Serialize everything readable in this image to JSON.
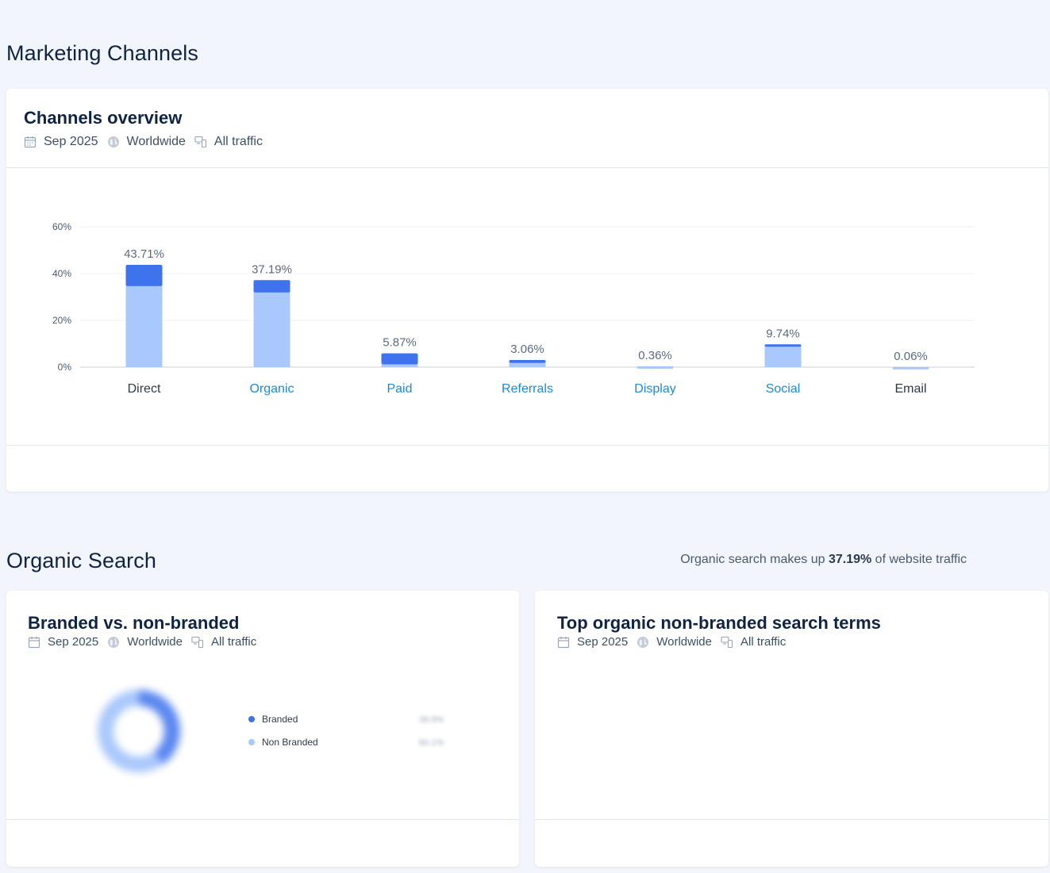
{
  "marketing": {
    "title": "Marketing Channels",
    "overview": {
      "title": "Channels overview",
      "meta": {
        "date": "Sep 2025",
        "region": "Worldwide",
        "traffic": "All traffic"
      }
    }
  },
  "chart_data": {
    "type": "bar",
    "stacked": true,
    "categories": [
      "Direct",
      "Organic",
      "Paid",
      "Referrals",
      "Display",
      "Social",
      "Email"
    ],
    "linked_categories": [
      "Organic",
      "Paid",
      "Referrals",
      "Display",
      "Social"
    ],
    "totals": [
      43.71,
      37.19,
      5.87,
      3.06,
      0.36,
      9.74,
      0.06
    ],
    "total_labels": [
      "43.71%",
      "37.19%",
      "5.87%",
      "3.06%",
      "0.36%",
      "9.74%",
      "0.06%"
    ],
    "series": [
      {
        "values": [
          34.6,
          31.9,
          1.2,
          1.8,
          0.36,
          9.0,
          0.06
        ],
        "color": "#a9c8fb"
      },
      {
        "values": [
          9.11,
          5.29,
          4.67,
          1.26,
          0.0,
          0.74,
          0.0
        ],
        "color": "#3f73ee"
      }
    ],
    "y_ticks": [
      "0%",
      "20%",
      "40%",
      "60%"
    ],
    "ylim": [
      0,
      60
    ],
    "grid": true
  },
  "organic": {
    "title": "Organic Search",
    "note_prefix": "Organic search makes up ",
    "note_value": "37.19%",
    "note_suffix": " of website traffic",
    "branded_card": {
      "title": "Branded vs. non-branded",
      "meta": {
        "date": "Sep 2025",
        "region": "Worldwide",
        "traffic": "All traffic"
      },
      "legend": [
        {
          "label": "Branded",
          "color": "#3f73ee",
          "value": "39.9%"
        },
        {
          "label": "Non Branded",
          "color": "#a9c8fb",
          "value": "60.1%"
        }
      ]
    },
    "terms_card": {
      "title": "Top organic non-branded search terms",
      "meta": {
        "date": "Sep 2025",
        "region": "Worldwide",
        "traffic": "All traffic"
      }
    }
  }
}
